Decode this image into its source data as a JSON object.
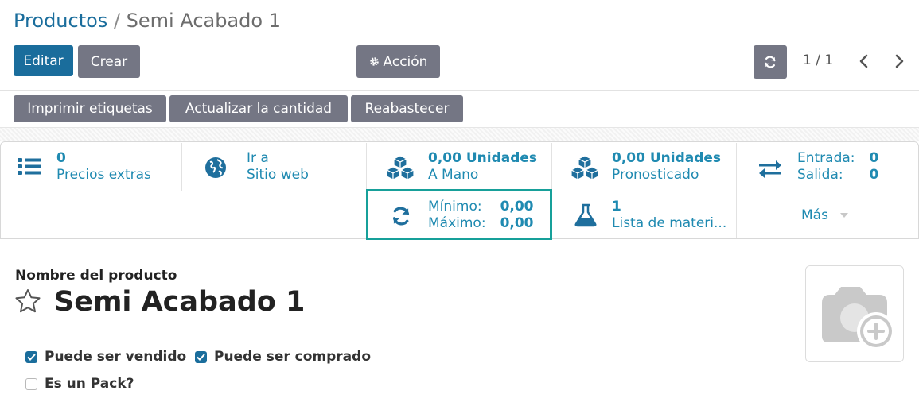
{
  "breadcrumb": {
    "parent": "Productos",
    "separator": " / ",
    "current": "Semi Acabado 1"
  },
  "toolbar": {
    "edit_label": "Editar",
    "create_label": "Crear",
    "action_label": "Acción",
    "pager_text": "1 / 1"
  },
  "header_buttons": {
    "print_labels": "Imprimir etiquetas",
    "update_qty": "Actualizar la cantidad",
    "replenish": "Reabastecer"
  },
  "stats": {
    "extra_prices": {
      "value": "0",
      "label": "Precios extras"
    },
    "website": {
      "line1": "Ir a",
      "line2": "Sitio web"
    },
    "on_hand": {
      "value": "0,00 Unidades",
      "label": "A Mano"
    },
    "forecasted": {
      "value": "0,00 Unidades",
      "label": "Pronosticado"
    },
    "in_out": {
      "in_label": "Entrada:",
      "in_value": "0",
      "out_label": "Salida:",
      "out_value": "0"
    },
    "reorder": {
      "min_label": "Mínimo:",
      "min_value": "0,00",
      "max_label": "Máximo:",
      "max_value": "0,00"
    },
    "bom": {
      "value": "1",
      "label": "Lista de materi..."
    },
    "more_label": "Más"
  },
  "form": {
    "name_label": "Nombre del producto",
    "name_value": "Semi Acabado 1",
    "checkboxes": {
      "sale_ok": {
        "label": "Puede ser vendido",
        "checked": true
      },
      "purchase_ok": {
        "label": "Puede ser comprado",
        "checked": true
      },
      "is_pack": {
        "label": "Es un Pack?",
        "checked": false
      }
    }
  },
  "colors": {
    "primary": "#1a6d9c",
    "secondary": "#747684",
    "stat_text": "#1f8ab1",
    "highlight": "#17a09a"
  }
}
